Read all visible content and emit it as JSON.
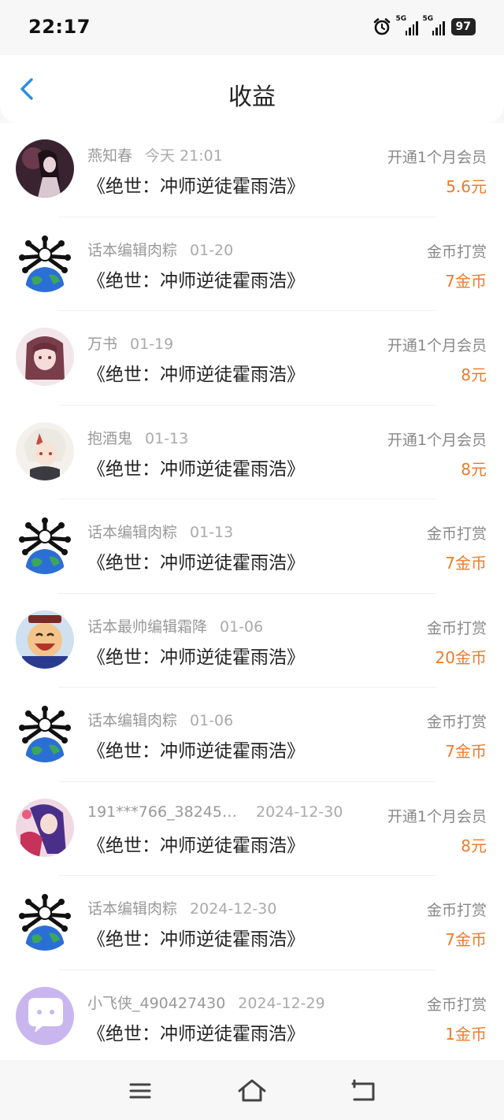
{
  "status_bar": {
    "time": "22:17",
    "signal_1": "5G",
    "signal_2": "5G",
    "battery": "97"
  },
  "header": {
    "title": "收益"
  },
  "colors": {
    "accent_blue": "#2a8de3",
    "amount_orange": "#f07a2a"
  },
  "entries": [
    {
      "user": "燕知春",
      "date": "今天 21:01",
      "book": "《绝世：冲师逆徒霍雨浩》",
      "type": "开通1个月会员",
      "amount": "5.6元",
      "avatar": "anime-girl-dark"
    },
    {
      "user": "话本编辑肉粽",
      "date": "01-20",
      "book": "《绝世：冲师逆徒霍雨浩》",
      "type": "金币打赏",
      "amount": "7金币",
      "avatar": "earth-icon"
    },
    {
      "user": "万书",
      "date": "01-19",
      "book": "《绝世：冲师逆徒霍雨浩》",
      "type": "开通1个月会员",
      "amount": "8元",
      "avatar": "anime-girl-pink"
    },
    {
      "user": "抱酒鬼",
      "date": "01-13",
      "book": "《绝世：冲师逆徒霍雨浩》",
      "type": "开通1个月会员",
      "amount": "8元",
      "avatar": "anime-boy-white-hair"
    },
    {
      "user": "话本编辑肉粽",
      "date": "01-13",
      "book": "《绝世：冲师逆徒霍雨浩》",
      "type": "金币打赏",
      "amount": "7金币",
      "avatar": "earth-icon"
    },
    {
      "user": "话本最帅编辑霜降",
      "date": "01-06",
      "book": "《绝世：冲师逆徒霍雨浩》",
      "type": "金币打赏",
      "amount": "20金币",
      "avatar": "cartoon-face"
    },
    {
      "user": "话本编辑肉粽",
      "date": "01-06",
      "book": "《绝世：冲师逆徒霍雨浩》",
      "type": "金币打赏",
      "amount": "7金币",
      "avatar": "earth-icon"
    },
    {
      "user": "191***766_38245…",
      "date": "2024-12-30",
      "book": "《绝世：冲师逆徒霍雨浩》",
      "type": "开通1个月会员",
      "amount": "8元",
      "avatar": "anime-girl-purple"
    },
    {
      "user": "话本编辑肉粽",
      "date": "2024-12-30",
      "book": "《绝世：冲师逆徒霍雨浩》",
      "type": "金币打赏",
      "amount": "7金币",
      "avatar": "earth-icon"
    },
    {
      "user": "小飞侠_490427430",
      "date": "2024-12-29",
      "book": "《绝世：冲师逆徒霍雨浩》",
      "type": "金币打赏",
      "amount": "1金币",
      "avatar": "chat-bubble-icon"
    }
  ],
  "nav": {
    "menu": "menu-icon",
    "home": "home-icon",
    "back": "back-icon"
  }
}
